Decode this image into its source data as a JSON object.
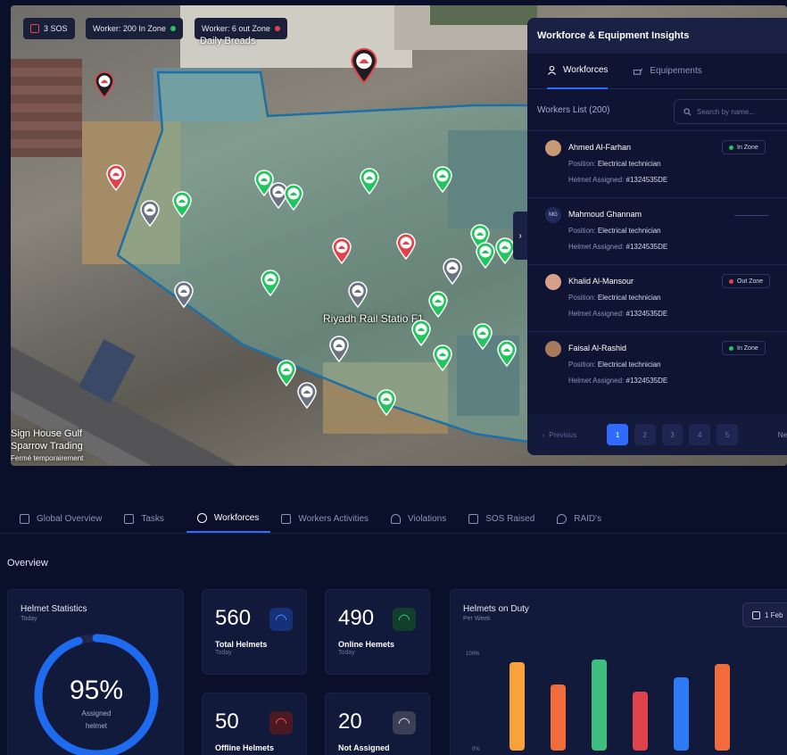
{
  "map": {
    "sos_chip": "3 SOS",
    "in_zone_chip": "Worker: 200 In Zone",
    "out_zone_chip": "Worker: 6 out Zone",
    "zone_label": "Riyadh Rail Statio F1",
    "poi_label_1": "Sign House Gulf",
    "poi_label_2": "Sparrow Trading",
    "poi_label_3": "Fermé temporairement",
    "top_label": "Daily Breads",
    "colors": {
      "in_zone": "#22c55e",
      "out_zone": "#e2434b",
      "sos": "#e2434b",
      "equipment": "#6b7280"
    }
  },
  "panel": {
    "title": "Workforce & Equipment Insights",
    "tabs": [
      {
        "label": "Workforces",
        "icon": "worker-icon"
      },
      {
        "label": "Equipements",
        "icon": "equipment-icon"
      }
    ],
    "list_title": "Workers List (200)",
    "search_placeholder": "Search by name...",
    "position_label": "Position:",
    "helmet_label": "Helmet Assigned:",
    "workers": [
      {
        "name": "Ahmed Al-Farhan",
        "position": "Electrical technician",
        "helmet": "#1324535DE",
        "status": "In Zone"
      },
      {
        "name": "Mahmoud Ghannam",
        "position": "Electrical technician",
        "helmet": "#1324535DE",
        "status": ""
      },
      {
        "name": "Khalid Al-Mansour",
        "position": "Electrical technician",
        "helmet": "#1324535DE",
        "status": "Out Zone"
      },
      {
        "name": "Faisal Al-Rashid",
        "position": "Electrical technician",
        "helmet": "#1324535DE",
        "status": "In Zone"
      }
    ],
    "avatar_initials": "MG",
    "pager": {
      "previous": "Previous",
      "pages": [
        "1",
        "2",
        "3",
        "4",
        "5"
      ],
      "next": "Ne"
    }
  },
  "nav": {
    "items": [
      "Global Overview",
      "Tasks",
      "Workforces",
      "Workers Activities",
      "Violations",
      "SOS Raised",
      "RAID's"
    ],
    "active": "Workforces"
  },
  "overview": {
    "heading": "Overview",
    "helmet_stats": {
      "title": "Helmet Statistics",
      "sub": "Today",
      "percent": "95%",
      "percent_value": 95,
      "caption_1": "Assigned",
      "caption_2": "helmet"
    },
    "total": {
      "value": "560",
      "label": "Total Helmets",
      "sub": "Today"
    },
    "online": {
      "value": "490",
      "label": "Online Hemets",
      "sub": "Today"
    },
    "offline": {
      "value": "50",
      "label": "Offline Helmets"
    },
    "not_assigned": {
      "value": "20",
      "label": "Not Assigned"
    },
    "duty": {
      "title": "Helmets on Duty",
      "sub": "Per Week",
      "date": "1 Feb"
    }
  },
  "chart_data": {
    "type": "bar",
    "title": "Helmets on Duty",
    "subtitle": "Per Week",
    "yticks": [
      "100%",
      "0%"
    ],
    "ylim": [
      0,
      100
    ],
    "values": [
      95,
      71,
      98,
      63,
      79,
      93
    ],
    "colors": [
      "#f7a23b",
      "#f26b3a",
      "#3dbf7f",
      "#e0434b",
      "#2f7bf6",
      "#f26b3a"
    ]
  }
}
